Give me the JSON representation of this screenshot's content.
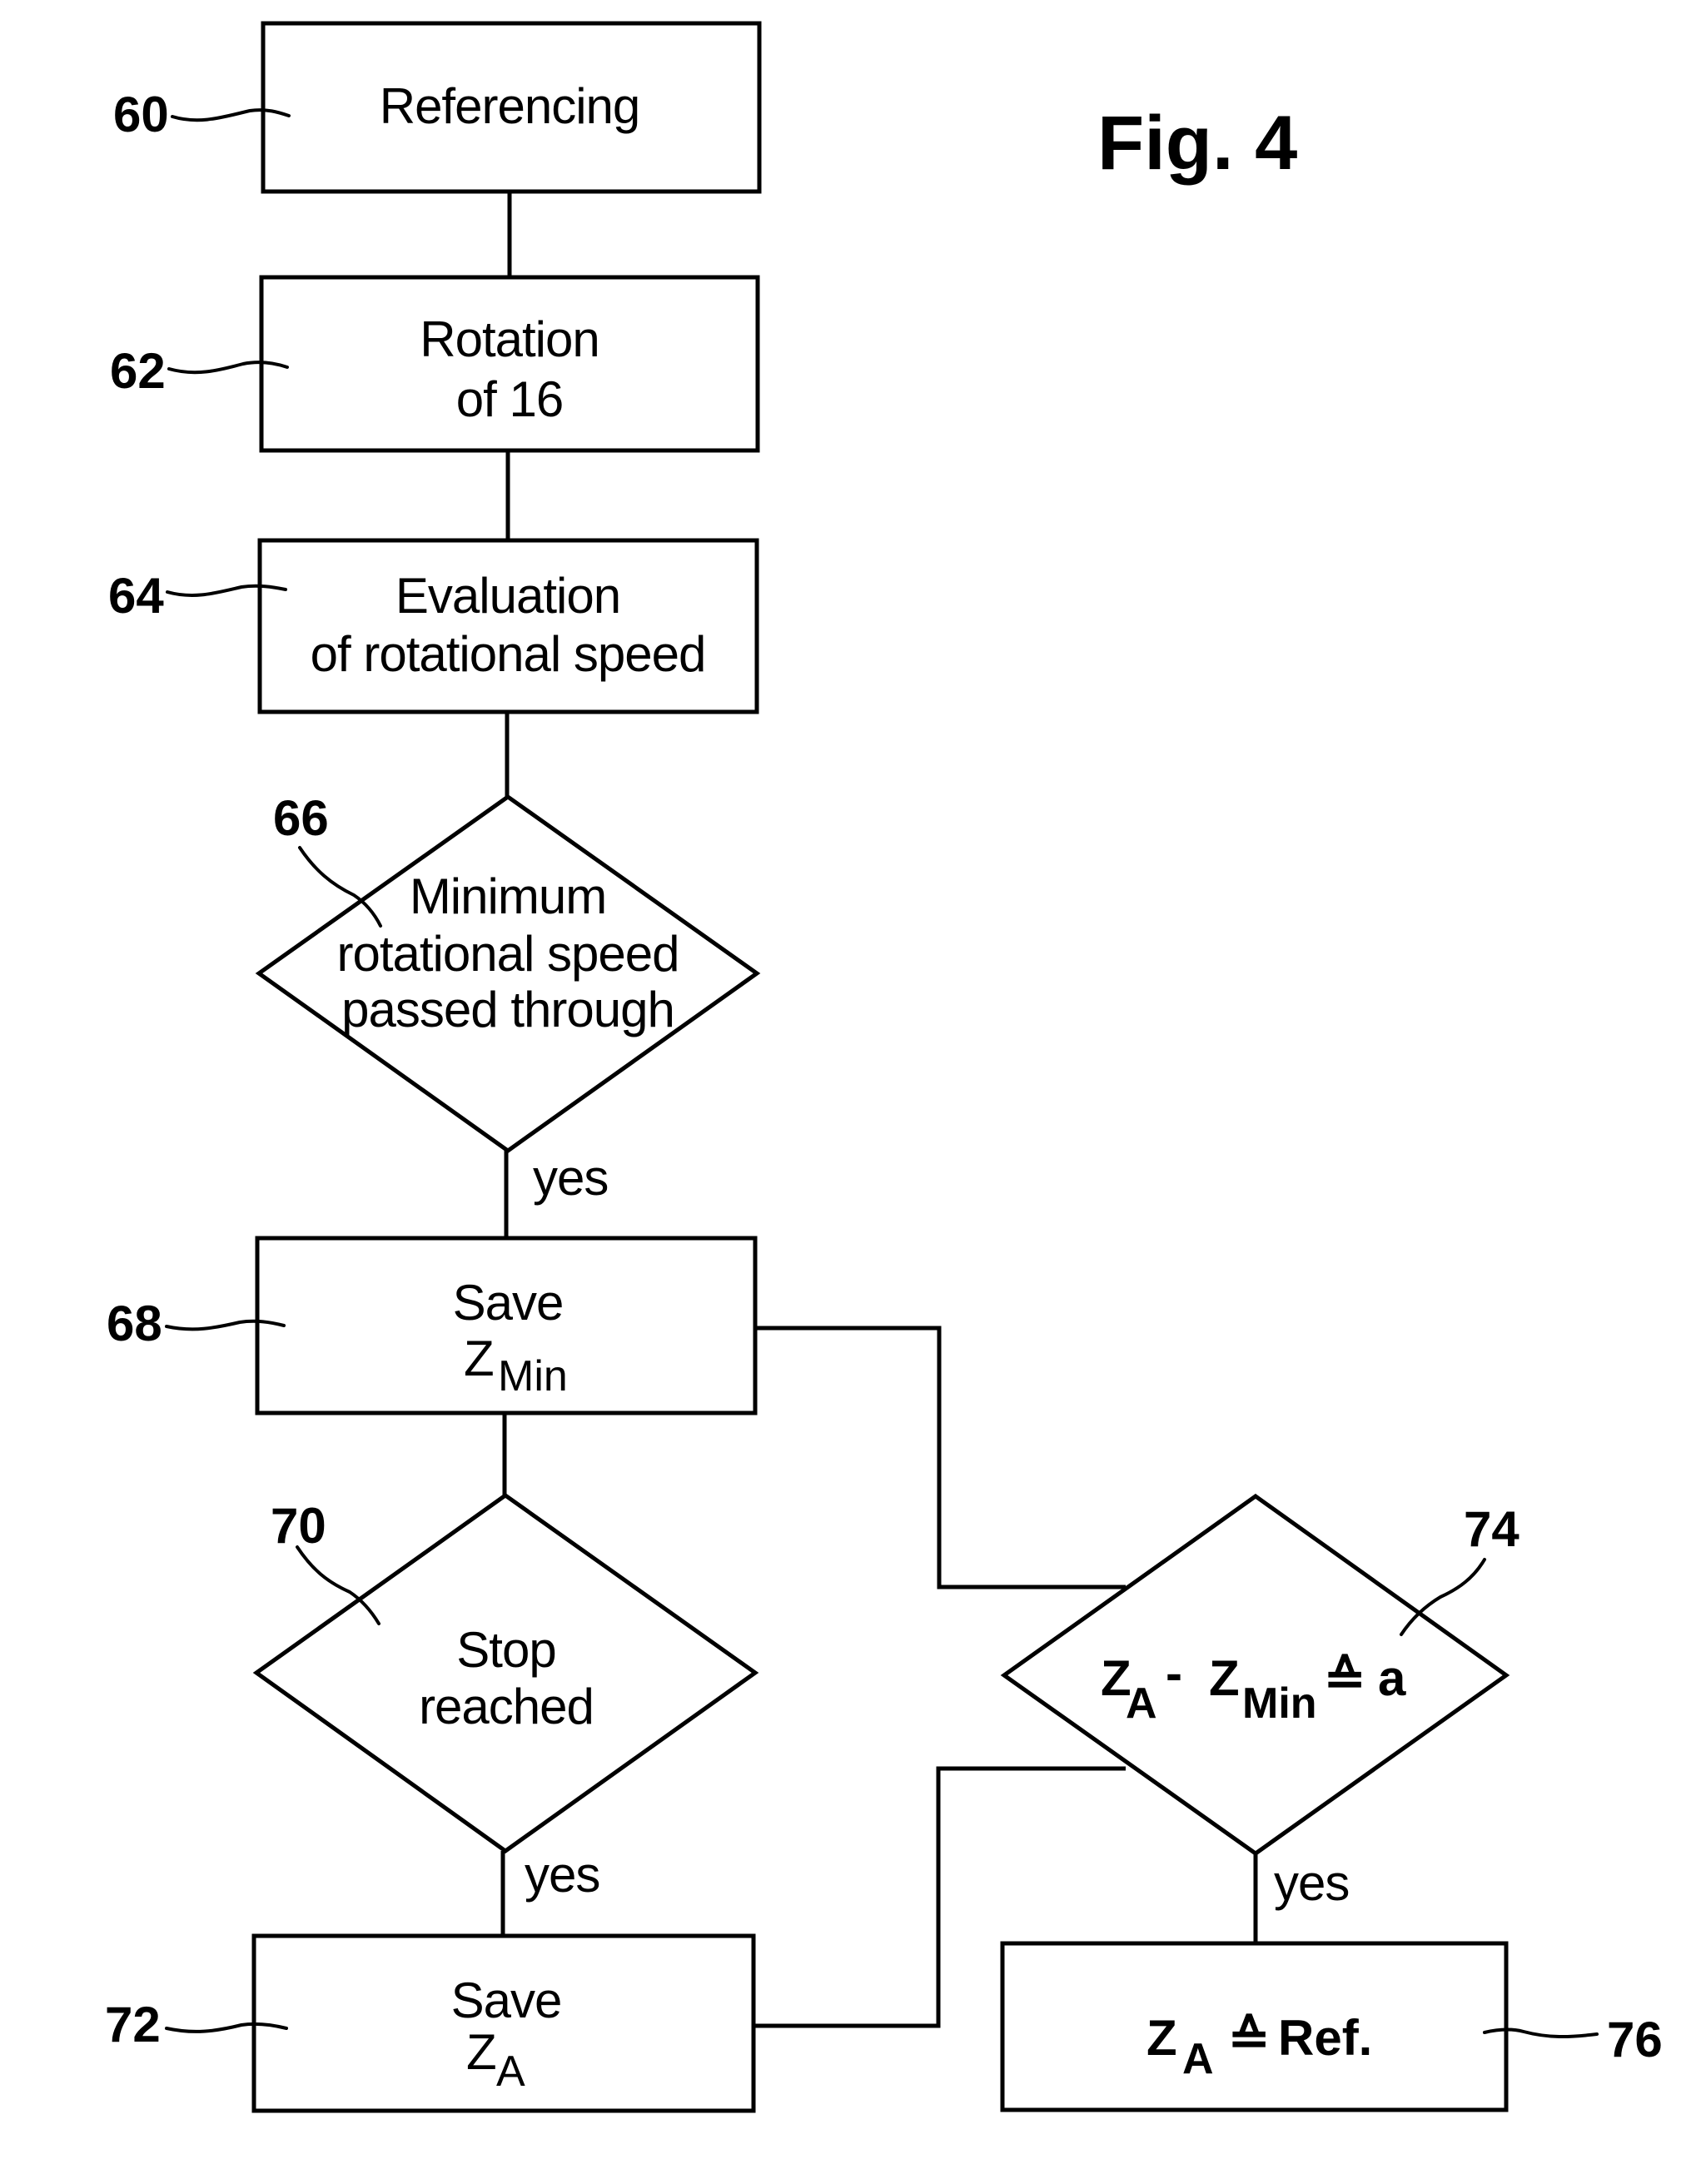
{
  "figure": {
    "title": "Fig. 4"
  },
  "steps": {
    "s60": {
      "ref": "60",
      "lines": [
        "Referencing"
      ]
    },
    "s62": {
      "ref": "62",
      "lines": [
        "Rotation",
        "of 16"
      ]
    },
    "s64": {
      "ref": "64",
      "lines": [
        "Evaluation",
        "of rotational speed"
      ]
    },
    "s66": {
      "ref": "66",
      "lines": [
        "Minimum",
        "rotational speed",
        "passed through"
      ],
      "branch": "yes"
    },
    "s68": {
      "ref": "68",
      "line1": "Save",
      "var": "Z",
      "sub": "Min"
    },
    "s70": {
      "ref": "70",
      "lines": [
        "Stop",
        "reached"
      ],
      "branch": "yes"
    },
    "s72": {
      "ref": "72",
      "line1": "Save",
      "var": "Z",
      "sub": "A"
    },
    "s74": {
      "ref": "74",
      "var1": "Z",
      "sub1": "A",
      "minus": "-",
      "var2": "Z",
      "sub2": "Min",
      "equiv": "≙",
      "rhs": "a",
      "branch": "yes"
    },
    "s76": {
      "ref": "76",
      "var": "Z",
      "sub": "A",
      "equiv": "≙",
      "rhs": "Ref."
    }
  }
}
